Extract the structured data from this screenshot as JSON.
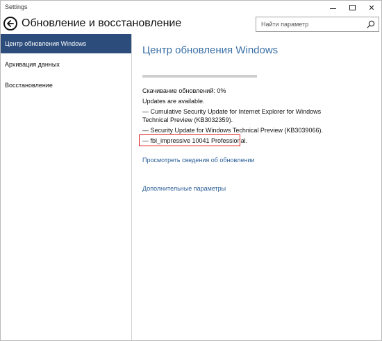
{
  "window": {
    "title": "Settings",
    "buttons": {
      "minimize": "minimize",
      "maximize": "maximize",
      "close": "✕"
    }
  },
  "header": {
    "title": "Обновление и восстановление",
    "search_placeholder": "Найти параметр"
  },
  "sidebar": {
    "items": [
      {
        "label": "Центр обновления Windows",
        "active": true
      },
      {
        "label": "Архивация данных",
        "active": false
      },
      {
        "label": "Восстановление",
        "active": false
      }
    ]
  },
  "main": {
    "title": "Центр обновления Windows",
    "progress_percent": 0,
    "status_lines": [
      "Скачивание обновлений: 0%",
      "Updates are available.",
      "— Cumulative Security Update for Internet Explorer for Windows",
      "Technical Preview (KB3032359).",
      "— Security Update for Windows Technical Preview (KB3039066).",
      "— fbl_impressive 10041 Professional."
    ],
    "links": {
      "view_details": "Просмотреть сведения об обновлении",
      "advanced_options": "Дополнительные параметры"
    }
  },
  "colors": {
    "accent": "#2c4d7c",
    "link": "#2c5f98",
    "title": "#3a6fa5",
    "highlight": "#e01f1f"
  }
}
